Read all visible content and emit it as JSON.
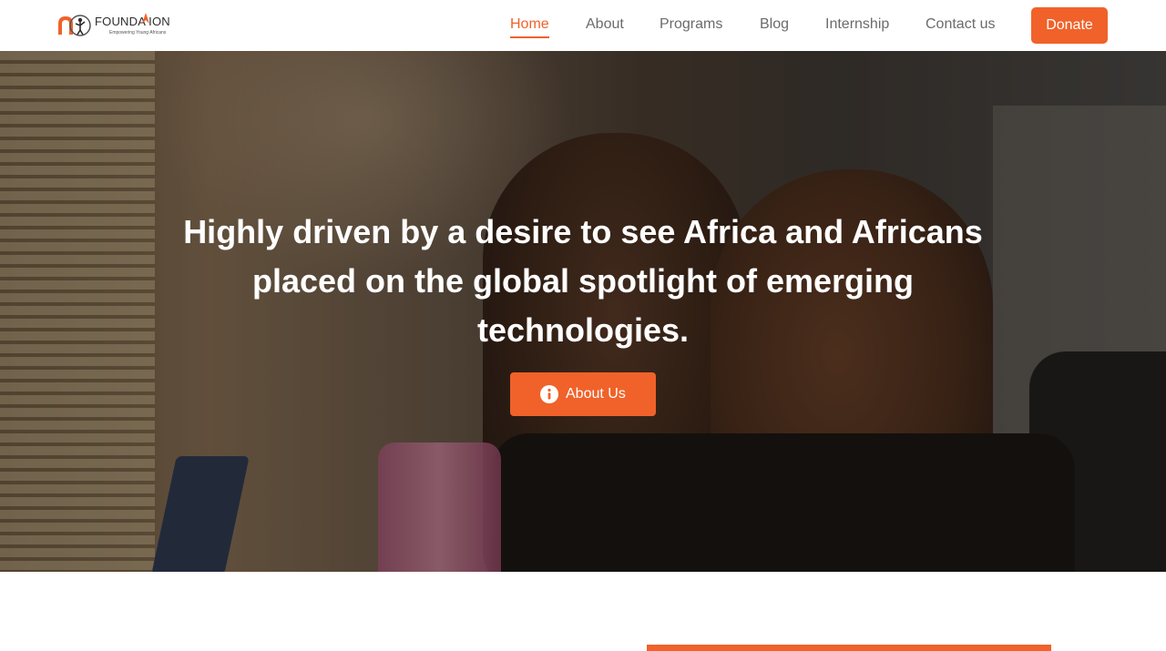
{
  "header": {
    "logo_text": "FOUNDA   ION",
    "logo_tagline": "Empowering Young Africans",
    "nav": [
      {
        "label": "Home",
        "active": true
      },
      {
        "label": "About",
        "active": false
      },
      {
        "label": "Programs",
        "active": false
      },
      {
        "label": "Blog",
        "active": false
      },
      {
        "label": "Internship",
        "active": false
      },
      {
        "label": "Contact us",
        "active": false
      }
    ],
    "donate_label": "Donate"
  },
  "hero": {
    "headline_line1": "Highly driven by a desire to see Africa and Africans",
    "headline_line2_prefix": "placed on the ",
    "headline_line2_bold1": "global",
    "headline_line2_middle": " spotlight of ",
    "headline_line2_bold2": "emerging",
    "headline_line3_bold": "technologies.",
    "about_button_label": "About Us",
    "about_button_icon": "info-icon"
  },
  "colors": {
    "accent": "#f0622a",
    "nav_text": "#6b6b6b",
    "white": "#ffffff"
  }
}
